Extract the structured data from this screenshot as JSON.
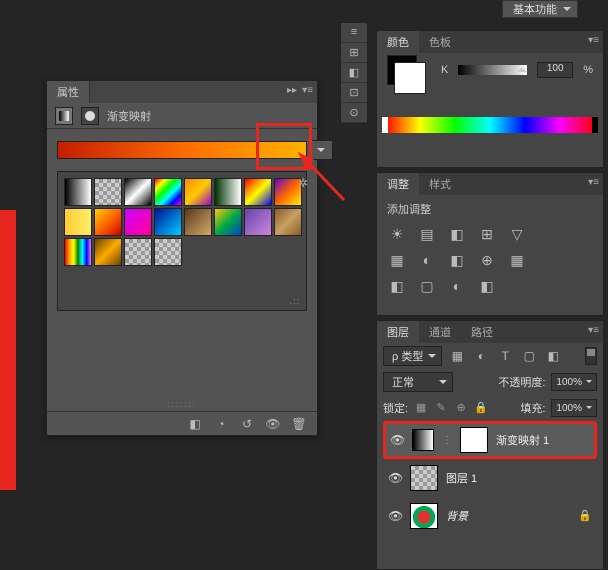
{
  "workspace": {
    "label": "基本功能"
  },
  "dock": {
    "icons": [
      "≡",
      "⊞",
      "◧",
      "⊡",
      "⊙"
    ]
  },
  "properties": {
    "tab": "属性",
    "title": "渐变映射",
    "footer_icons": [
      "◧",
      "◔",
      "↺",
      "👁",
      "🗑"
    ]
  },
  "gear_icon": "✲",
  "color_panel": {
    "tabs": [
      "颜色",
      "色板"
    ],
    "mode": "K",
    "value": "100",
    "unit": "%"
  },
  "adjust_panel": {
    "tabs": [
      "调整",
      "样式"
    ],
    "title": "添加调整",
    "rows": [
      [
        "☀",
        "▤",
        "◧",
        "⊞",
        "▽"
      ],
      [
        "▦",
        "◐",
        "◧",
        "⊕",
        "▦"
      ],
      [
        "◧",
        "▢",
        "◐",
        "◧"
      ]
    ]
  },
  "layers_panel": {
    "tabs": [
      "图层",
      "通道",
      "路径"
    ],
    "kind_select": "ρ 类型",
    "filter_icons": [
      "▦",
      "◐",
      "T",
      "▢",
      "◧"
    ],
    "blend_mode": "正常",
    "opacity_label": "不透明度:",
    "opacity_value": "100%",
    "lock_label": "锁定:",
    "lock_icons": [
      "▦",
      "✎",
      "⊕",
      "🔒"
    ],
    "fill_label": "填充:",
    "fill_value": "100%",
    "layers": [
      {
        "name": "渐变映射 1",
        "type": "adjustment",
        "visible": true,
        "selected": true
      },
      {
        "name": "图层 1",
        "type": "image",
        "visible": true
      },
      {
        "name": "背景",
        "type": "background",
        "visible": true,
        "locked": true
      }
    ]
  },
  "chart_data": null
}
